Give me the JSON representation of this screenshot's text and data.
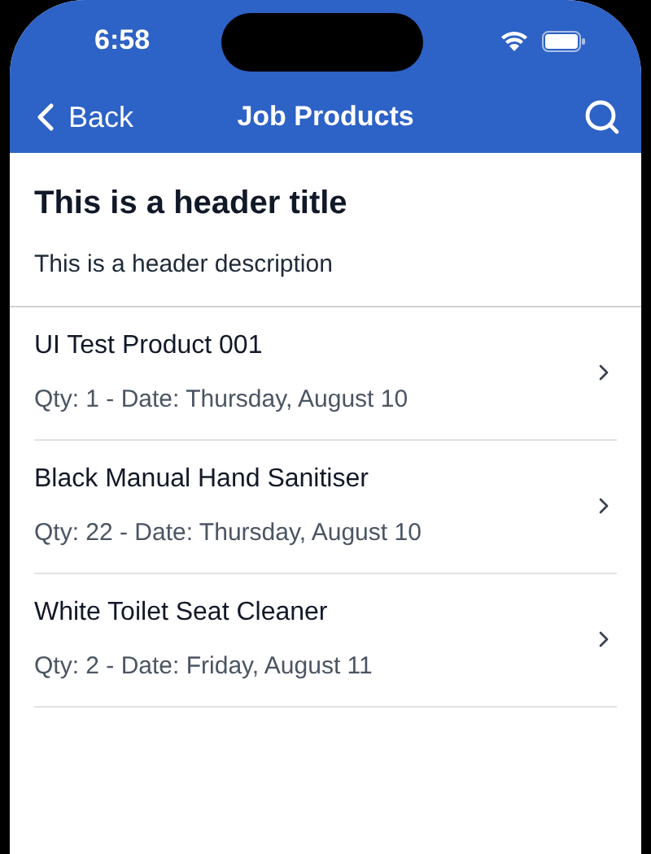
{
  "status_bar": {
    "time": "6:58"
  },
  "nav_bar": {
    "back_label": "Back",
    "title": "Job Products"
  },
  "header": {
    "title": "This is a header title",
    "description": "This is a header description"
  },
  "products": [
    {
      "name": "UI Test Product 001",
      "details": "Qty: 1 - Date: Thursday, August 10"
    },
    {
      "name": "Black Manual Hand Sanitiser",
      "details": "Qty: 22 - Date: Thursday, August 10"
    },
    {
      "name": "White Toilet Seat Cleaner",
      "details": "Qty: 2 - Date: Friday, August 11"
    }
  ]
}
